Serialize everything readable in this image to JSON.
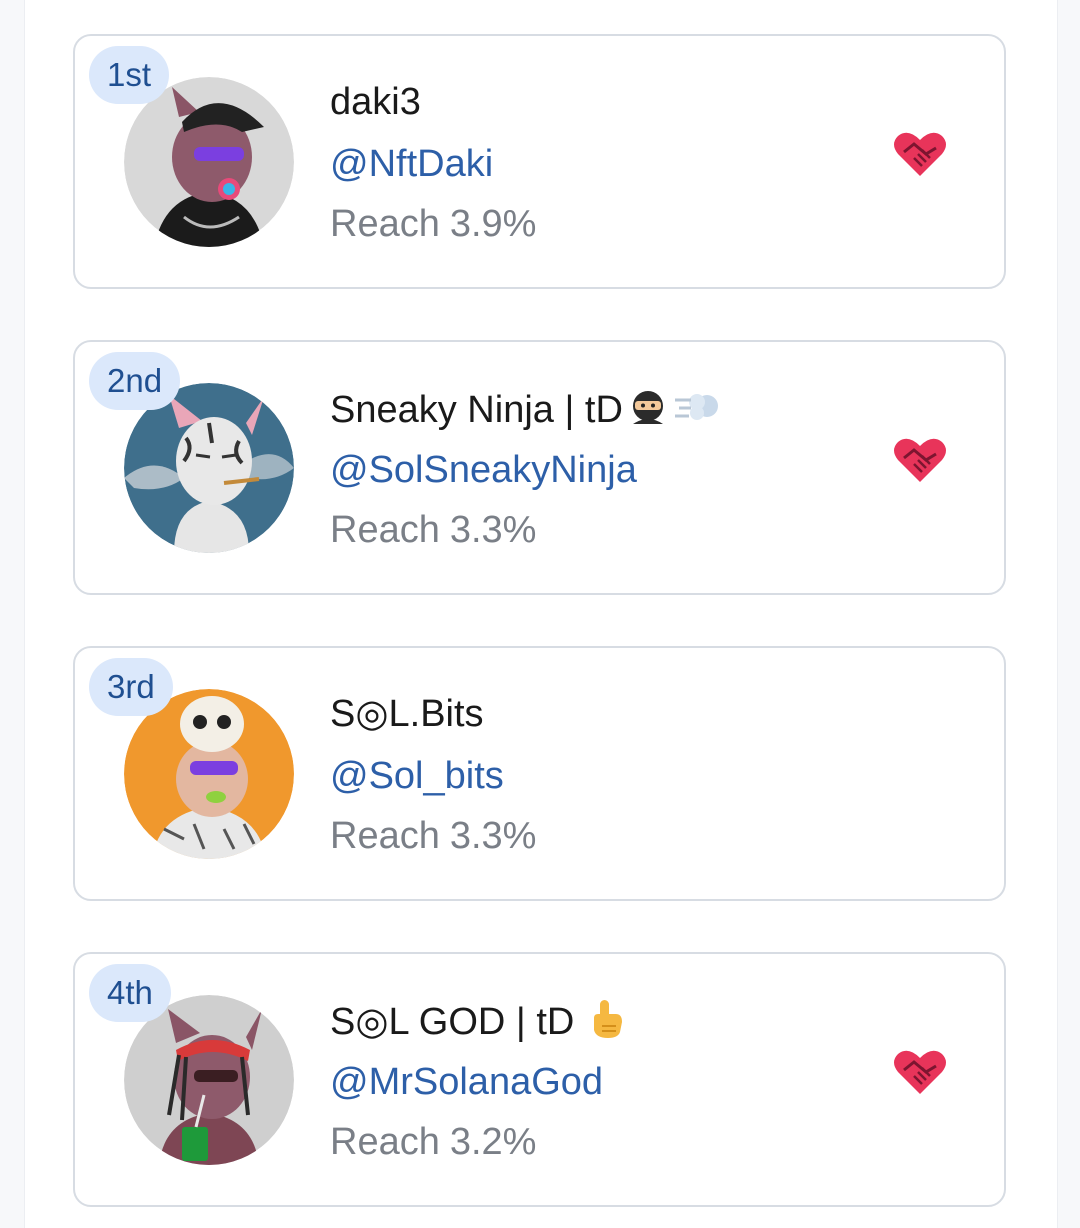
{
  "leaderboard": {
    "entries": [
      {
        "rank": "1st",
        "name": "daki3",
        "handle": "@NftDaki",
        "reach_label": "Reach",
        "reach_value": "3.9%",
        "avatar_icon": "cat-nft-avatar-cap-sunglasses",
        "avatar_bg": "#d8d8d8",
        "has_heart": true
      },
      {
        "rank": "2nd",
        "name": "Sneaky Ninja | tD",
        "name_emojis": [
          "ninja-emoji",
          "dash-emoji"
        ],
        "handle": "@SolSneakyNinja",
        "reach_label": "Reach",
        "reach_value": "3.3%",
        "avatar_icon": "cat-nft-avatar-smoking",
        "avatar_bg": "#3f6f8c",
        "has_heart": true
      },
      {
        "rank": "3rd",
        "name": "S◎L.Bits",
        "handle": "@Sol_bits",
        "reach_label": "Reach",
        "reach_value": "3.3%",
        "avatar_icon": "cat-nft-avatar-skull-hat",
        "avatar_bg": "#f0982d",
        "has_heart": false
      },
      {
        "rank": "4th",
        "name": "S◎L GOD | tD",
        "name_emojis": [
          "pointing-up-emoji"
        ],
        "handle": "@MrSolanaGod",
        "reach_label": "Reach",
        "reach_value": "3.2%",
        "avatar_icon": "cat-nft-avatar-bandana-drink",
        "avatar_bg": "#cfcfcf",
        "has_heart": true
      }
    ]
  },
  "colors": {
    "badge_bg": "#dbe8fb",
    "badge_text": "#1f4f91",
    "handle": "#2d5fa8",
    "reach": "#7a7f87",
    "card_border": "#d7dce3",
    "heart": "#e8345a"
  }
}
